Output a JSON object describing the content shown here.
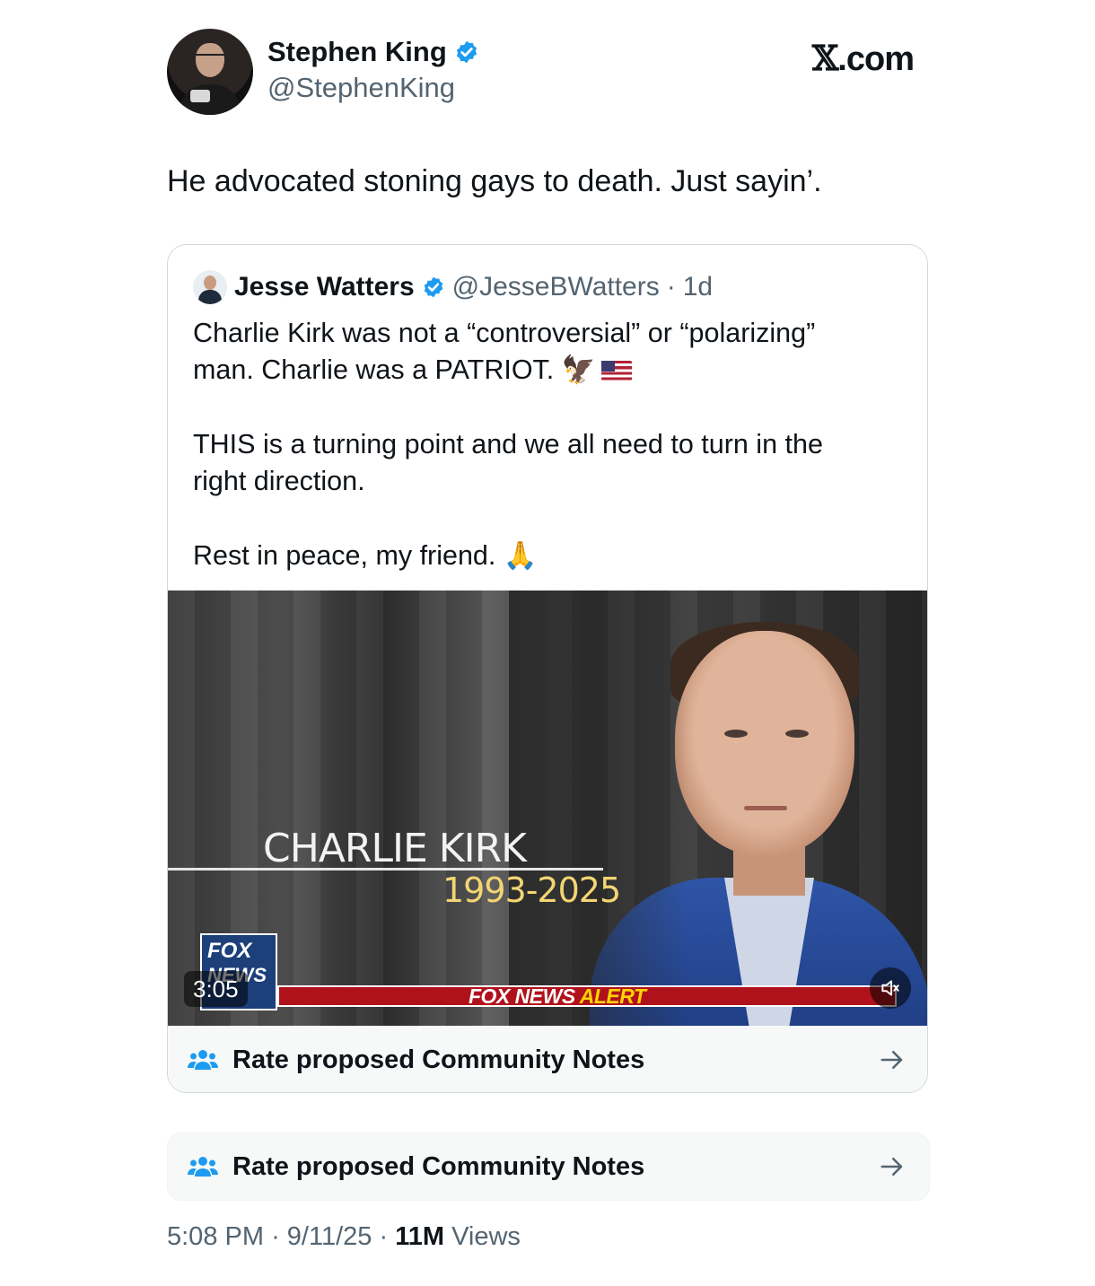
{
  "author": {
    "name": "Stephen King",
    "handle": "@StephenKing",
    "verified": true
  },
  "brand": {
    "logo_x": "𝕏",
    "logo_suffix": ".com"
  },
  "tweet": {
    "text": "He advocated stoning gays to death. Just sayin’."
  },
  "quote": {
    "name": "Jesse Watters",
    "handle": "@JesseBWatters",
    "separator": "·",
    "age": "1d",
    "line1": "Charlie Kirk was not a “controversial” or “polarizing”",
    "line2": "man. Charlie was a PATRIOT. 🦅",
    "line3": "THIS is a turning point and we all need to turn in the",
    "line4": "right direction.",
    "line5": "Rest in peace, my friend. 🙏",
    "media": {
      "tribute_name": "CHARLIE KIRK",
      "tribute_years": "1993-2025",
      "fox_top": "FOX",
      "fox_bottom": "NEWS",
      "alert_prefix": "FOX NEWS",
      "alert_word": "ALERT",
      "timecode": "3:05"
    },
    "community_notes_label": "Rate proposed Community Notes"
  },
  "community_notes_label": "Rate proposed Community Notes",
  "footer": {
    "time": "5:08 PM",
    "sep1": "·",
    "date": "9/11/25",
    "sep2": "·",
    "views_count": "11M",
    "views_label": "Views"
  },
  "colors": {
    "verified": "#1d9bf0",
    "muted_text": "#536471",
    "alert_red": "#b0121c",
    "alert_yellow": "#ffd400"
  }
}
